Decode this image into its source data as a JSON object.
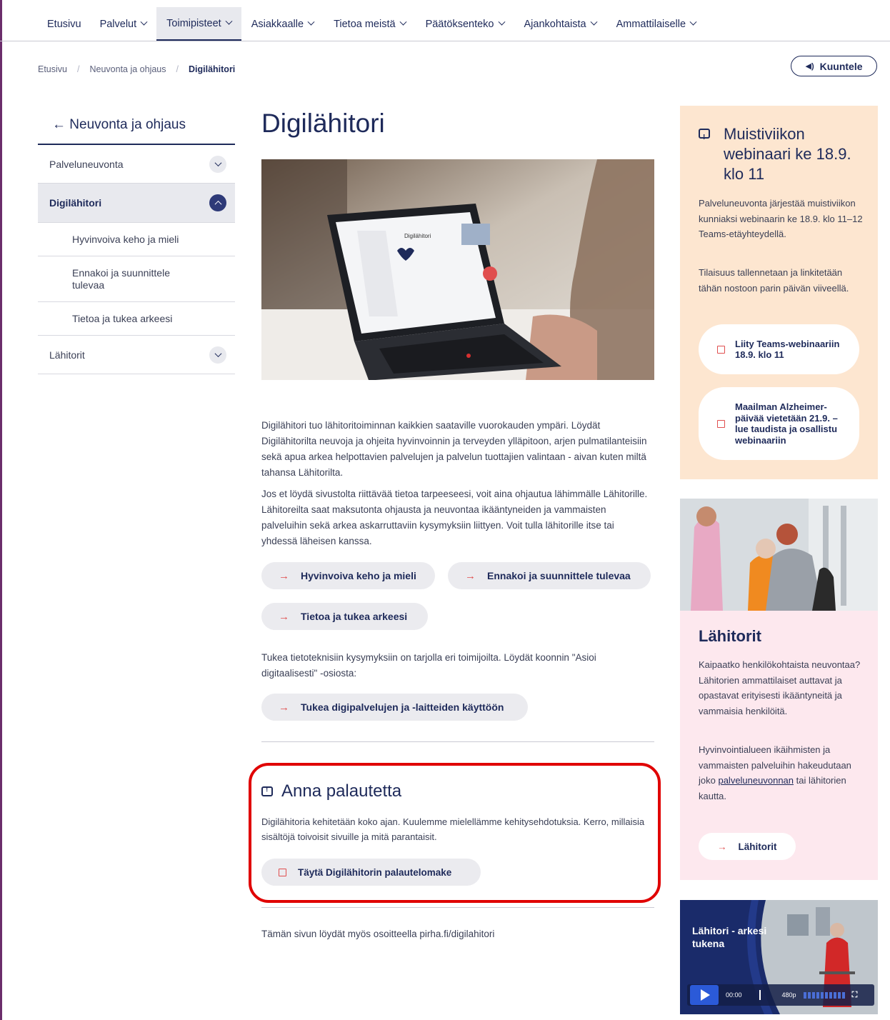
{
  "nav": {
    "items": [
      {
        "label": "Etusivu",
        "dropdown": false,
        "active": false
      },
      {
        "label": "Palvelut",
        "dropdown": true,
        "active": false
      },
      {
        "label": "Toimipisteet",
        "dropdown": true,
        "active": true
      },
      {
        "label": "Asiakkaalle",
        "dropdown": true,
        "active": false
      },
      {
        "label": "Tietoa meistä",
        "dropdown": true,
        "active": false
      },
      {
        "label": "Päätöksenteko",
        "dropdown": true,
        "active": false
      },
      {
        "label": "Ajankohtaista",
        "dropdown": true,
        "active": false
      },
      {
        "label": "Ammattilaiselle",
        "dropdown": true,
        "active": false
      }
    ]
  },
  "breadcrumb": {
    "items": [
      "Etusivu",
      "Neuvonta ja ohjaus"
    ],
    "current": "Digilähitori",
    "separator": "/"
  },
  "listen_button": {
    "label": "Kuuntele",
    "icon": "speaker-icon"
  },
  "sidebar": {
    "back_label": "← Neuvonta ja ohjaus",
    "items": [
      {
        "label": "Palveluneuvonta",
        "expanded": false
      },
      {
        "label": "Digilähitori",
        "expanded": true,
        "active": true
      },
      {
        "label": "Hyvinvoiva keho ja mieli",
        "sub": true
      },
      {
        "label": "Ennakoi ja suunnittele tulevaa",
        "sub": true
      },
      {
        "label": "Tietoa ja tukea arkeesi",
        "sub": true
      },
      {
        "label": "Lähitorit",
        "expanded": false
      }
    ]
  },
  "main": {
    "title": "Digilähitori",
    "hero_screen_title": "Digilähitori",
    "para1": "Digilähitori tuo lähitoritoiminnan kaikkien saataville vuorokauden ympäri. Löydät Digilähitorilta neuvoja ja ohjeita hyvinvoinnin ja terveyden ylläpitoon, arjen pulmatilanteisiin sekä apua arkea helpottavien palvelujen ja palvelun tuottajien valintaan - aivan kuten miltä tahansa Lähitorilta.",
    "para2": "Jos et löydä sivustolta riittävää tietoa tarpeeseesi, voit aina ohjautua lähimmälle Lähitorille. Lähitoreilta saat maksutonta ohjausta ja neuvontaa ikääntyneiden ja vammaisten palveluihin sekä arkea askarruttaviin kysymyksiin liittyen. Voit tulla lähitorille itse tai yhdessä läheisen kanssa.",
    "links": [
      "Hyvinvoiva keho ja mieli",
      "Ennakoi ja suunnittele tulevaa",
      "Tietoa ja tukea arkeesi"
    ],
    "para3": "Tukea tietoteknisiin kysymyksiin on tarjolla eri toimijoilta. Löydät koonnin \"Asioi digitaalisesti\" -osiosta:",
    "digi_link": "Tukea digipalvelujen ja -laitteiden käyttöön",
    "feedback": {
      "title": "Anna palautetta",
      "text": "Digilähitoria kehitetään koko ajan. Kuulemme mielellämme kehitysehdotuksia. Kerro, millaisia sisältöjä toivoisit sivuille ja mitä parantaisit.",
      "button": "Täytä Digilähitorin palautelomake"
    },
    "footer_note": "Tämän sivun löydät myös osoitteella pirha.fi/digilahitori"
  },
  "webinar_card": {
    "title": "Muistiviikon webinaari ke 18.9. klo 11",
    "text1": "Palveluneuvonta järjestää muistiviikon kunniaksi webinaarin ke 18.9. klo 11–12 Teams-etäyhteydellä.",
    "text2": "Tilaisuus tallennetaan ja linkitetään tähän nostoon parin päivän viiveellä.",
    "button1": "Liity Teams-webinaariin 18.9. klo 11",
    "button2": "Maailman Alzheimer-päivää vietetään 21.9. – lue taudista ja osallistu webinaariin"
  },
  "lahitorit_card": {
    "title": "Lähitorit",
    "text1": "Kaipaatko henkilökohtaista neuvontaa? Lähitorien ammattilaiset auttavat ja opastavat erityisesti ikääntyneitä ja vammaisia henkilöitä.",
    "text2_pre": "Hyvinvointialueen ikäihmisten ja vammaisten palveluihin hakeudutaan joko ",
    "text2_link": "palveluneuvonnan",
    "text2_post": " tai lähitorien kautta.",
    "button": "Lähitorit"
  },
  "video": {
    "title": "Lähitori - arkesi tukena",
    "time": "00:00",
    "quality": "480p"
  },
  "colors": {
    "navy": "#1e2a5a",
    "accent_red": "#e04e4e",
    "highlight_box": "#e00000",
    "webinar_bg": "#fde6d0",
    "lahitorit_bg": "#fde8ee",
    "pill_bg": "#ebebef"
  }
}
